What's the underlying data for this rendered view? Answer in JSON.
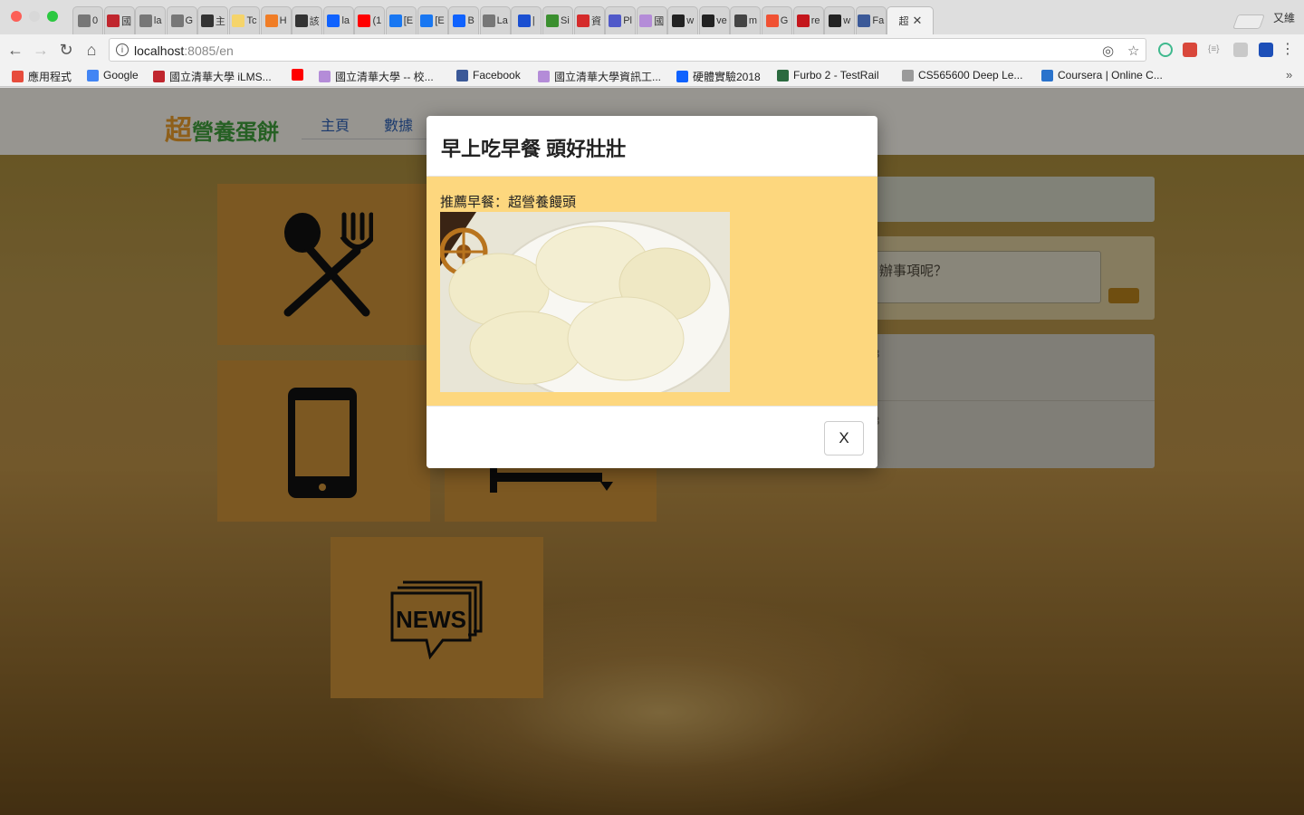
{
  "browser": {
    "tabs": [
      {
        "label": "0",
        "icon_name": "doc-icon",
        "color": "#777777"
      },
      {
        "label": "國",
        "icon_name": "ilms-icon",
        "color": "#c0262e"
      },
      {
        "label": "la",
        "icon_name": "doc-icon",
        "color": "#777777"
      },
      {
        "label": "G",
        "icon_name": "doc-icon",
        "color": "#777777"
      },
      {
        "label": "主",
        "icon_name": "wikipedia-icon",
        "color": "#333333"
      },
      {
        "label": "Tc",
        "icon_name": "sticky-note-icon",
        "color": "#f5d46b"
      },
      {
        "label": "H",
        "icon_name": "loader-icon",
        "color": "#f07d26"
      },
      {
        "label": "該",
        "icon_name": "edit-icon",
        "color": "#333333"
      },
      {
        "label": "la",
        "icon_name": "dropbox-icon",
        "color": "#0f62fe"
      },
      {
        "label": "(1",
        "icon_name": "youtube-icon",
        "color": "#ff0000"
      },
      {
        "label": "[E",
        "icon_name": "diamond-icon",
        "color": "#1877f2"
      },
      {
        "label": "[E",
        "icon_name": "diamond-icon",
        "color": "#1877f2"
      },
      {
        "label": "B",
        "icon_name": "dropbox-icon",
        "color": "#0f62fe"
      },
      {
        "label": "La",
        "icon_name": "doc-icon",
        "color": "#777777"
      },
      {
        "label": "|",
        "icon_name": "chat-icon",
        "color": "#1a4fd1"
      },
      {
        "label": "Si",
        "icon_name": "mygov-icon",
        "color": "#3b8f2f"
      },
      {
        "label": "資",
        "icon_name": "pdf-icon",
        "color": "#d52b2b"
      },
      {
        "label": "Pl",
        "icon_name": "teams-icon",
        "color": "#5059c9"
      },
      {
        "label": "國",
        "icon_name": "nthu-icon",
        "color": "#b48cd8"
      },
      {
        "label": "w",
        "icon_name": "github-icon",
        "color": "#222222"
      },
      {
        "label": "ve",
        "icon_name": "github-icon",
        "color": "#222222"
      },
      {
        "label": "m",
        "icon_name": "book-icon",
        "color": "#444444"
      },
      {
        "label": "G",
        "icon_name": "git-icon",
        "color": "#f05133"
      },
      {
        "label": "re",
        "icon_name": "n-icon",
        "color": "#c4161c"
      },
      {
        "label": "w",
        "icon_name": "github-icon",
        "color": "#222222"
      },
      {
        "label": "Fa",
        "icon_name": "facebook-icon",
        "color": "#3b5998"
      }
    ],
    "active_tab": {
      "label": "超",
      "close": "✕"
    },
    "profile_name": "又維",
    "url_host": "localhost",
    "url_path": ":8085/en",
    "bookmarks": [
      {
        "label": "應用程式",
        "icon_name": "apps-grid-icon",
        "color": "#e74c3c"
      },
      {
        "label": "Google",
        "icon_name": "google-icon",
        "color": "#4285f4"
      },
      {
        "label": "國立清華大學 iLMS...",
        "icon_name": "ilms-icon",
        "color": "#c0262e"
      },
      {
        "label": "",
        "icon_name": "youtube-icon",
        "color": "#ff0000"
      },
      {
        "label": "國立清華大學 -- 校...",
        "icon_name": "nthu-icon",
        "color": "#b48cd8"
      },
      {
        "label": "Facebook",
        "icon_name": "facebook-icon",
        "color": "#3b5998"
      },
      {
        "label": "國立清華大學資訊工...",
        "icon_name": "nthu-icon",
        "color": "#b48cd8"
      },
      {
        "label": "硬體實驗2018",
        "icon_name": "dropbox-icon",
        "color": "#0f62fe"
      },
      {
        "label": "Furbo 2 - TestRail",
        "icon_name": "testrail-icon",
        "color": "#2b6a3f"
      },
      {
        "label": "CS565600 Deep Le...",
        "icon_name": "nthu-icon",
        "color": "#9a9a9a"
      },
      {
        "label": "Coursera | Online C...",
        "icon_name": "coursera-icon",
        "color": "#2a73cc"
      }
    ]
  },
  "site": {
    "logo_big": "超",
    "logo_rest": "營養蛋餅",
    "nav": [
      "主頁",
      "數據"
    ],
    "todo_placeholder": "辦事項呢？",
    "list_rows": [
      "3",
      "3"
    ]
  },
  "modal": {
    "title": "早上吃早餐 頭好壯壯",
    "text": "推薦早餐：超營養饅頭",
    "close_label": "X"
  },
  "colors": {
    "tile": "#c98f37",
    "modal_body": "#fdd77e",
    "logo_orange": "#e59a2a",
    "logo_green": "#3e9b3a"
  }
}
